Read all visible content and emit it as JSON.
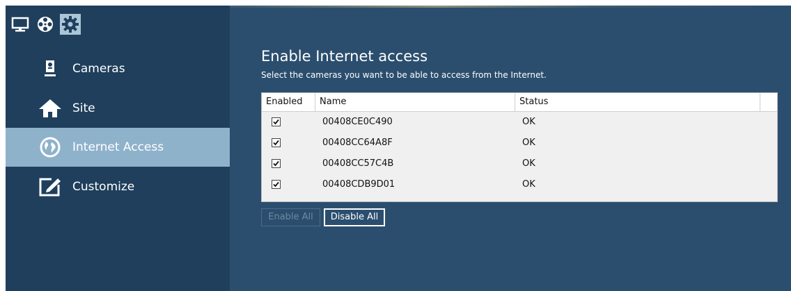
{
  "top_tabs": [
    {
      "icon": "monitor-icon",
      "active": false
    },
    {
      "icon": "film-reel-icon",
      "active": false
    },
    {
      "icon": "gear-icon",
      "active": true
    }
  ],
  "sidebar": {
    "items": [
      {
        "label": "Cameras",
        "icon": "camera-icon",
        "active": false
      },
      {
        "label": "Site",
        "icon": "house-icon",
        "active": false
      },
      {
        "label": "Internet Access",
        "icon": "globe-icon",
        "active": true
      },
      {
        "label": "Customize",
        "icon": "edit-frame-icon",
        "active": false
      }
    ]
  },
  "main": {
    "title": "Enable Internet access",
    "subtitle": "Select the cameras you want to be able to access from the Internet.",
    "table": {
      "columns": [
        "Enabled",
        "Name",
        "Status"
      ],
      "rows": [
        {
          "enabled": true,
          "name": "00408CE0C490",
          "status": "OK"
        },
        {
          "enabled": true,
          "name": "00408CC64A8F",
          "status": "OK"
        },
        {
          "enabled": true,
          "name": "00408CC57C4B",
          "status": "OK"
        },
        {
          "enabled": true,
          "name": "00408CDB9D01",
          "status": "OK"
        }
      ]
    },
    "buttons": {
      "enable_all": "Enable All",
      "disable_all": "Disable All"
    }
  },
  "colors": {
    "background": "#2b4e6e",
    "sidebar": "#1f3f5c",
    "sidebar_active": "#8fb2cb",
    "text": "#ffffff"
  }
}
